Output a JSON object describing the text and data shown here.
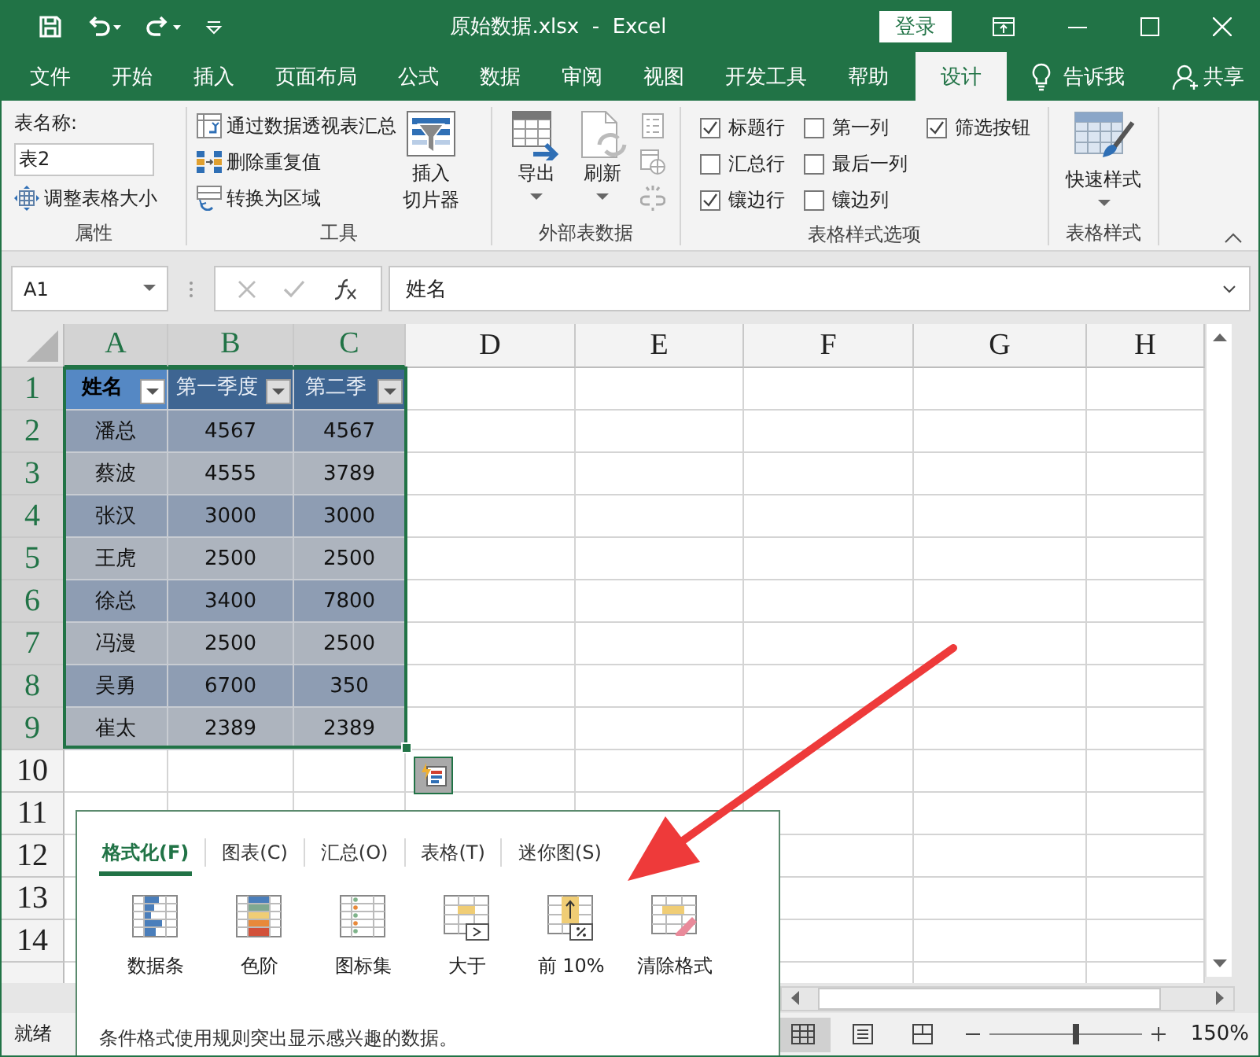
{
  "title_bar": {
    "title": "原始数据.xlsx  -  Excel",
    "login": "登录"
  },
  "ribbon_tabs": [
    {
      "label": "文件",
      "selected": false
    },
    {
      "label": "开始",
      "selected": false
    },
    {
      "label": "插入",
      "selected": false
    },
    {
      "label": "页面布局",
      "selected": false
    },
    {
      "label": "公式",
      "selected": false
    },
    {
      "label": "数据",
      "selected": false
    },
    {
      "label": "审阅",
      "selected": false
    },
    {
      "label": "视图",
      "selected": false
    },
    {
      "label": "开发工具",
      "selected": false
    },
    {
      "label": "帮助",
      "selected": false
    },
    {
      "label": "设计",
      "selected": true
    }
  ],
  "tell_me": "告诉我",
  "share": "共享",
  "properties_group": {
    "label": "属性",
    "table_name_label": "表名称:",
    "table_name": "表2",
    "resize": "调整表格大小"
  },
  "tools_group": {
    "label": "工具",
    "commands": [
      "通过数据透视表汇总",
      "删除重复值",
      "转换为区域"
    ],
    "insert_slicer": [
      "插入",
      "切片器"
    ]
  },
  "external_group": {
    "label": "外部表数据",
    "export": "导出",
    "refresh": "刷新"
  },
  "style_options_group": {
    "label": "表格样式选项",
    "options": [
      {
        "label": "标题行",
        "checked": true
      },
      {
        "label": "汇总行",
        "checked": false
      },
      {
        "label": "镶边行",
        "checked": true
      },
      {
        "label": "第一列",
        "checked": false
      },
      {
        "label": "最后一列",
        "checked": false
      },
      {
        "label": "镶边列",
        "checked": false
      },
      {
        "label": "筛选按钮",
        "checked": true
      }
    ]
  },
  "table_styles_group": {
    "label": "表格样式",
    "quick_styles": "快速样式"
  },
  "formula_bar": {
    "name_box": "A1",
    "formula": "姓名"
  },
  "sheet": {
    "columns": [
      {
        "label": "A",
        "selected": true
      },
      {
        "label": "B",
        "selected": true
      },
      {
        "label": "C",
        "selected": true
      },
      {
        "label": "D",
        "selected": false
      },
      {
        "label": "E",
        "selected": false
      },
      {
        "label": "F",
        "selected": false
      },
      {
        "label": "G",
        "selected": false
      },
      {
        "label": "H",
        "selected": false
      }
    ],
    "rows": [
      {
        "label": "1",
        "selected": true
      },
      {
        "label": "2",
        "selected": true
      },
      {
        "label": "3",
        "selected": true
      },
      {
        "label": "4",
        "selected": true
      },
      {
        "label": "5",
        "selected": true
      },
      {
        "label": "6",
        "selected": true
      },
      {
        "label": "7",
        "selected": true
      },
      {
        "label": "8",
        "selected": true
      },
      {
        "label": "9",
        "selected": true
      },
      {
        "label": "10",
        "selected": false
      },
      {
        "label": "11",
        "selected": false
      },
      {
        "label": "12",
        "selected": false
      },
      {
        "label": "13",
        "selected": false
      },
      {
        "label": "14",
        "selected": false
      }
    ]
  },
  "table": {
    "headers": [
      "姓名",
      "第一季度",
      "第二季"
    ],
    "rows": [
      [
        "潘总",
        "4567",
        "4567"
      ],
      [
        "蔡波",
        "4555",
        "3789"
      ],
      [
        "张汉",
        "3000",
        "3000"
      ],
      [
        "王虎",
        "2500",
        "2500"
      ],
      [
        "徐总",
        "3400",
        "7800"
      ],
      [
        "冯漫",
        "2500",
        "2500"
      ],
      [
        "吴勇",
        "6700",
        "350"
      ],
      [
        "崔太",
        "2389",
        "2389"
      ]
    ]
  },
  "quick_analysis": {
    "tabs": [
      {
        "label": "格式化(F)",
        "selected": true
      },
      {
        "label": "图表(C)",
        "selected": false
      },
      {
        "label": "汇总(O)",
        "selected": false
      },
      {
        "label": "表格(T)",
        "selected": false
      },
      {
        "label": "迷你图(S)",
        "selected": false
      }
    ],
    "items": [
      {
        "label": "数据条",
        "kind": "data-bars"
      },
      {
        "label": "色阶",
        "kind": "color-scale"
      },
      {
        "label": "图标集",
        "kind": "icon-set"
      },
      {
        "label": "大于",
        "kind": "greater-than"
      },
      {
        "label": "前 10%",
        "kind": "top-ten"
      },
      {
        "label": "清除格式",
        "kind": "clear"
      }
    ],
    "description": "条件格式使用规则突出显示感兴趣的数据。"
  },
  "status_bar": {
    "status": "就绪",
    "views": [
      {
        "kind": "normal",
        "selected": true
      },
      {
        "kind": "page-layout",
        "selected": false
      },
      {
        "kind": "page-break",
        "selected": false
      }
    ],
    "zoom": {
      "level": 0.57,
      "reading": "150%"
    }
  }
}
